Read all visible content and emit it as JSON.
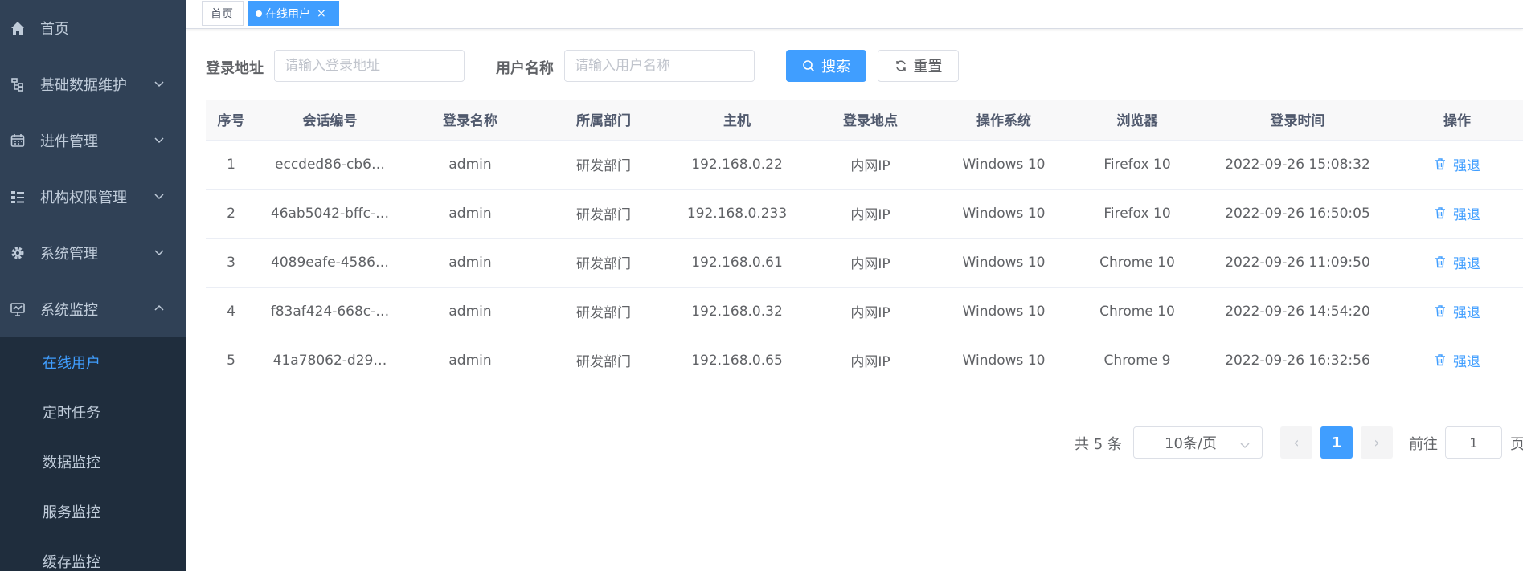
{
  "sidebar": {
    "items": [
      {
        "label": "首页"
      },
      {
        "label": "基础数据维护"
      },
      {
        "label": "进件管理"
      },
      {
        "label": "机构权限管理"
      },
      {
        "label": "系统管理"
      },
      {
        "label": "系统监控"
      }
    ],
    "submenu": [
      {
        "label": "在线用户"
      },
      {
        "label": "定时任务"
      },
      {
        "label": "数据监控"
      },
      {
        "label": "服务监控"
      },
      {
        "label": "缓存监控"
      }
    ]
  },
  "tags": {
    "home": "首页",
    "active": "在线用户"
  },
  "search": {
    "ip_label": "登录地址",
    "ip_placeholder": "请输入登录地址",
    "user_label": "用户名称",
    "user_placeholder": "请输入用户名称",
    "search_button": "搜索",
    "reset_button": "重置"
  },
  "table": {
    "headers": [
      "序号",
      "会话编号",
      "登录名称",
      "所属部门",
      "主机",
      "登录地点",
      "操作系统",
      "浏览器",
      "登录时间",
      "操作"
    ],
    "rows": [
      [
        "1",
        "eccded86-cb6…",
        "admin",
        "研发部门",
        "192.168.0.22",
        "内网IP",
        "Windows 10",
        "Firefox 10",
        "2022-09-26 15:08:32",
        "强退"
      ],
      [
        "2",
        "46ab5042-bffc-…",
        "admin",
        "研发部门",
        "192.168.0.233",
        "内网IP",
        "Windows 10",
        "Firefox 10",
        "2022-09-26 16:50:05",
        "强退"
      ],
      [
        "3",
        "4089eafe-4586…",
        "admin",
        "研发部门",
        "192.168.0.61",
        "内网IP",
        "Windows 10",
        "Chrome 10",
        "2022-09-26 11:09:50",
        "强退"
      ],
      [
        "4",
        "f83af424-668c-…",
        "admin",
        "研发部门",
        "192.168.0.32",
        "内网IP",
        "Windows 10",
        "Chrome 10",
        "2022-09-26 14:54:20",
        "强退"
      ],
      [
        "5",
        "41a78062-d29…",
        "admin",
        "研发部门",
        "192.168.0.65",
        "内网IP",
        "Windows 10",
        "Chrome 9",
        "2022-09-26 16:32:56",
        "强退"
      ]
    ]
  },
  "pagination": {
    "total": "共 5 条",
    "page_size": "10条/页",
    "prev": "‹",
    "current": "1",
    "next": "›",
    "goto_label": "前往",
    "goto_value": "1",
    "page_suffix": "页"
  },
  "colors": {
    "sidebar_bg": "#304156",
    "submenu_bg": "#1f2d3d",
    "primary": "#409eff"
  }
}
